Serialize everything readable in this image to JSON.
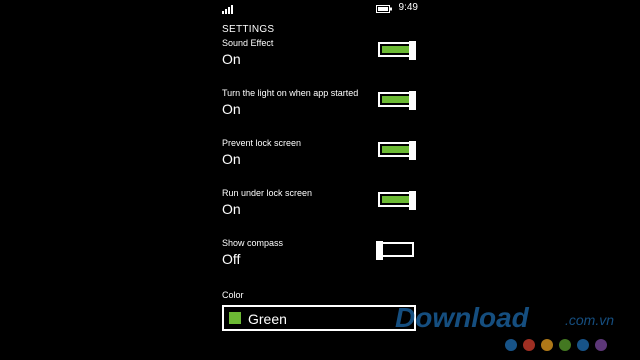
{
  "status_bar": {
    "time": "9:49"
  },
  "section_title": "SETTINGS",
  "settings": [
    {
      "label": "Sound Effect",
      "value": "On",
      "on": true
    },
    {
      "label": "Turn the light on when app started",
      "value": "On",
      "on": true
    },
    {
      "label": "Prevent lock screen",
      "value": "On",
      "on": true
    },
    {
      "label": "Run under lock screen",
      "value": "On",
      "on": true
    },
    {
      "label": "Show compass",
      "value": "Off",
      "on": false
    }
  ],
  "color": {
    "label": "Color",
    "value": "Green",
    "swatch": "#6cb934"
  },
  "watermark": {
    "brand": "Download",
    "domain": ".com.vn"
  },
  "colors": {
    "background": "#000000",
    "accent": "#6cb934"
  }
}
